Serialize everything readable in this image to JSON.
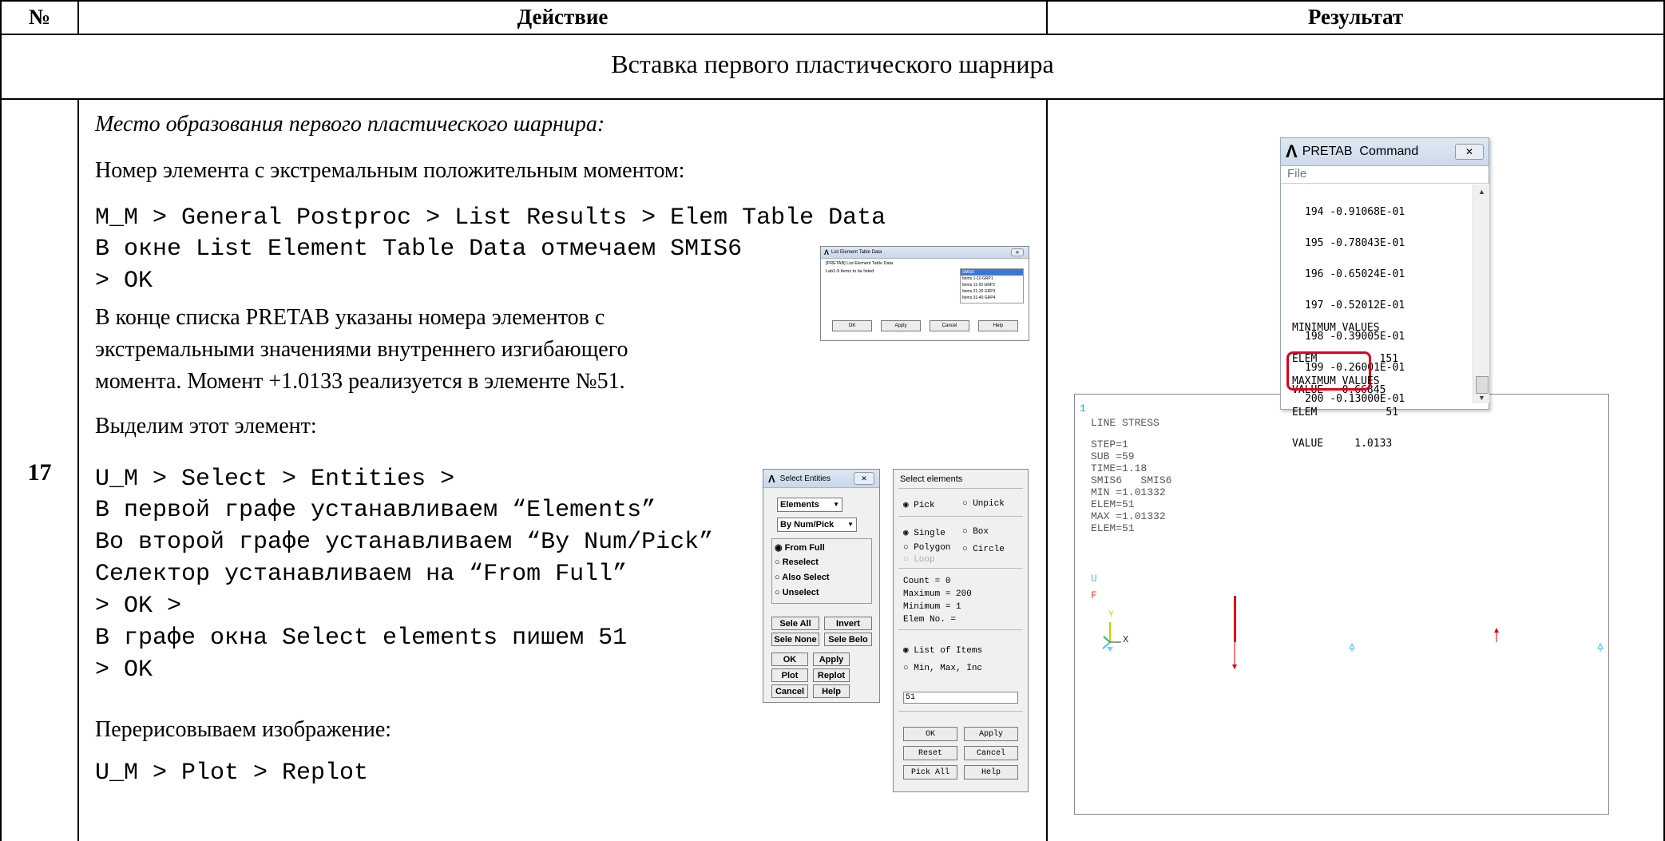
{
  "table": {
    "header": {
      "num": "№",
      "action": "Действие",
      "result": "Результат"
    },
    "section_title": "Вставка первого пластического шарнира",
    "row_number": "17"
  },
  "action": {
    "heading": "Место образования первого пластического шарнира:",
    "p1": "Номер элемента с экстремальным положительным моментом:",
    "cmd1": "M_M > General Postproc > List Results > Elem Table Data",
    "cmd2": "В окне List Element Table Data отмечаем SMIS6",
    "cmd3": "> OK",
    "p2_l1": "В конце списка PRETAB указаны номера элементов с",
    "p2_l2": "экстремальными значениями внутреннего изгибающего",
    "p2_l3": "момента. Момент +1.0133 реализуется в элементе №51.",
    "p3": "Выделим этот элемент:",
    "sel1": "U_M > Select > Entities >",
    "sel2": "В первой графе устанавливаем “Elements”",
    "sel3": "Во второй графе устанавливаем “By Num/Pick”",
    "sel4": "Селектор устанавливаем на “From Full”",
    "sel5": "> OK >",
    "sel6": "В графе окна Select elements пишем 51",
    "sel7": "> OK",
    "p4": "Перерисовываем изображение:",
    "cmd4": "U_M > Plot > Replot"
  },
  "let_dialog": {
    "title": "List Element Table Data",
    "row_label": "[PRETAB] List Element Table Data",
    "field_label": "Lab1-9  Items to be listed",
    "items": [
      "SMIS6",
      "Items 1-10 GRP1",
      "Items 11-20 GRP2",
      "Items 21-30 GRP3",
      "Items 31-40 GRP4"
    ],
    "buttons": [
      "OK",
      "Apply",
      "Cancel",
      "Help"
    ]
  },
  "select_entities": {
    "title": "Select Entities",
    "combo1": "Elements",
    "combo2": "By Num/Pick",
    "radios": [
      "From Full",
      "Reselect",
      "Also Select",
      "Unselect"
    ],
    "buttons": [
      "Sele All",
      "Invert",
      "Sele None",
      "Sele Belo",
      "OK",
      "Apply",
      "Plot",
      "Replot",
      "Cancel",
      "Help"
    ]
  },
  "select_elements": {
    "title": "Select elements",
    "pick": "Pick",
    "unpick": "Unpick",
    "single": "Single",
    "box": "Box",
    "polygon": "Polygon",
    "circle": "Circle",
    "loop": "Loop",
    "count_lbl": "Count",
    "count_val": "0",
    "max_lbl": "Maximum",
    "max_val": "200",
    "min_lbl": "Minimum",
    "min_val": "1",
    "elemno_lbl": "Elem No. =",
    "list_items": "List of Items",
    "min_max_inc": "Min, Max, Inc",
    "input_value": "51",
    "buttons": [
      "OK",
      "Apply",
      "Reset",
      "Cancel",
      "Pick All",
      "Help"
    ]
  },
  "pretab": {
    "title": "PRETAB  Command",
    "menu": "File",
    "rows": [
      "194 -0.91068E-01",
      "195 -0.78043E-01",
      "196 -0.65024E-01",
      "197 -0.52012E-01",
      "198 -0.39005E-01",
      "199 -0.26001E-01",
      "200 -0.13000E-01"
    ],
    "min_title": "MINIMUM VALUES",
    "min_elem_lbl": "ELEM",
    "min_elem_val": "151",
    "min_value_lbl": "VALUE",
    "min_value_val": "-0.66845",
    "max_title": "MAXIMUM VALUES",
    "max_elem_lbl": "ELEM",
    "max_elem_val": "51",
    "max_value_lbl": "VALUE",
    "max_value_val": "1.0133",
    "highlight_color": "#e0001b"
  },
  "graphics": {
    "corner": "1",
    "lines": [
      "LINE STRESS",
      "STEP=1",
      "SUB =59",
      "TIME=1.18",
      "SMIS6   SMIS6",
      "MIN =1.01332",
      "ELEM=51",
      "MAX =1.01332",
      "ELEM=51"
    ],
    "u_label": "U",
    "f_label": "F",
    "axis_y": "Y",
    "axis_x": "X"
  }
}
